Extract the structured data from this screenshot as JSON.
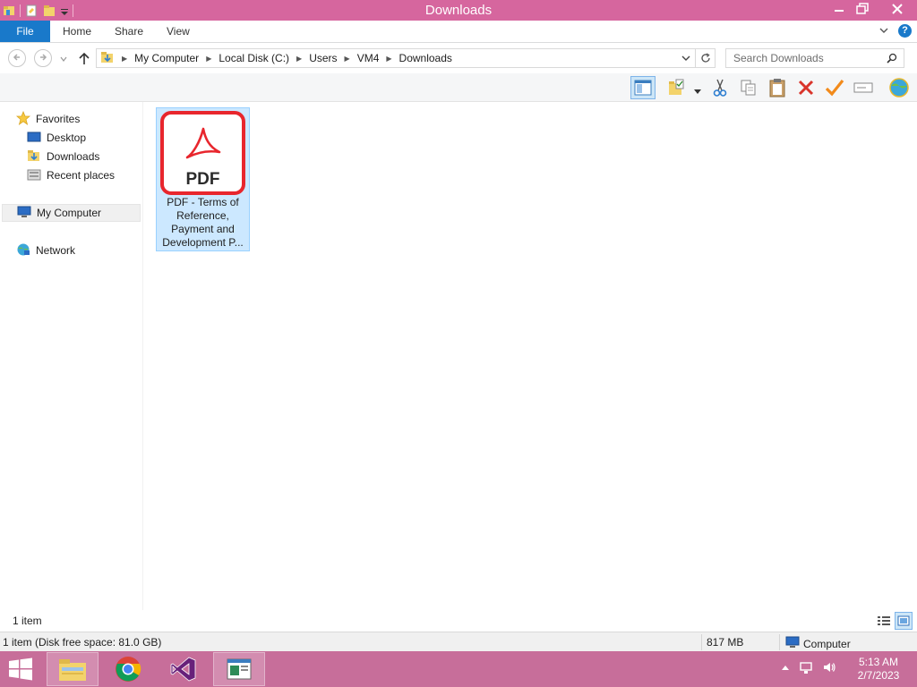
{
  "window": {
    "title": "Downloads"
  },
  "ribbon": {
    "tabs": [
      {
        "label": "File"
      },
      {
        "label": "Home"
      },
      {
        "label": "Share"
      },
      {
        "label": "View"
      }
    ],
    "help_label": "?"
  },
  "address": {
    "breadcrumbs": [
      "My Computer",
      "Local Disk (C:)",
      "Users",
      "VM4",
      "Downloads"
    ],
    "search_placeholder": "Search Downloads"
  },
  "toolbar": {
    "icons": [
      "details-pane-icon",
      "properties-folder-icon",
      "cut-icon",
      "copy-icon",
      "paste-icon",
      "delete-icon",
      "checkmark-icon",
      "rename-icon",
      "network-globe-icon"
    ]
  },
  "navpane": {
    "favorites_label": "Favorites",
    "favorites": [
      {
        "label": "Desktop"
      },
      {
        "label": "Downloads"
      },
      {
        "label": "Recent places"
      }
    ],
    "computer_label": "My Computer",
    "network_label": "Network"
  },
  "files": [
    {
      "icon_text": "PDF",
      "name": "PDF - Terms of Reference, Payment and Development P...",
      "selected": true
    }
  ],
  "status": {
    "item_count": "1 item",
    "disk_info": "1 item (Disk free space: 81.0 GB)",
    "size": "817 MB",
    "location": "Computer"
  },
  "taskbar": {
    "time": "5:13 AM",
    "date": "2/7/2023",
    "apps": [
      "file-explorer",
      "chrome",
      "visual-studio",
      "app-window"
    ]
  },
  "colors": {
    "titlebar": "#d6669e",
    "taskbar": "#c76e9a",
    "accent": "#1979ca",
    "selection": "#cce8ff",
    "pdf_red": "#e8262d"
  }
}
